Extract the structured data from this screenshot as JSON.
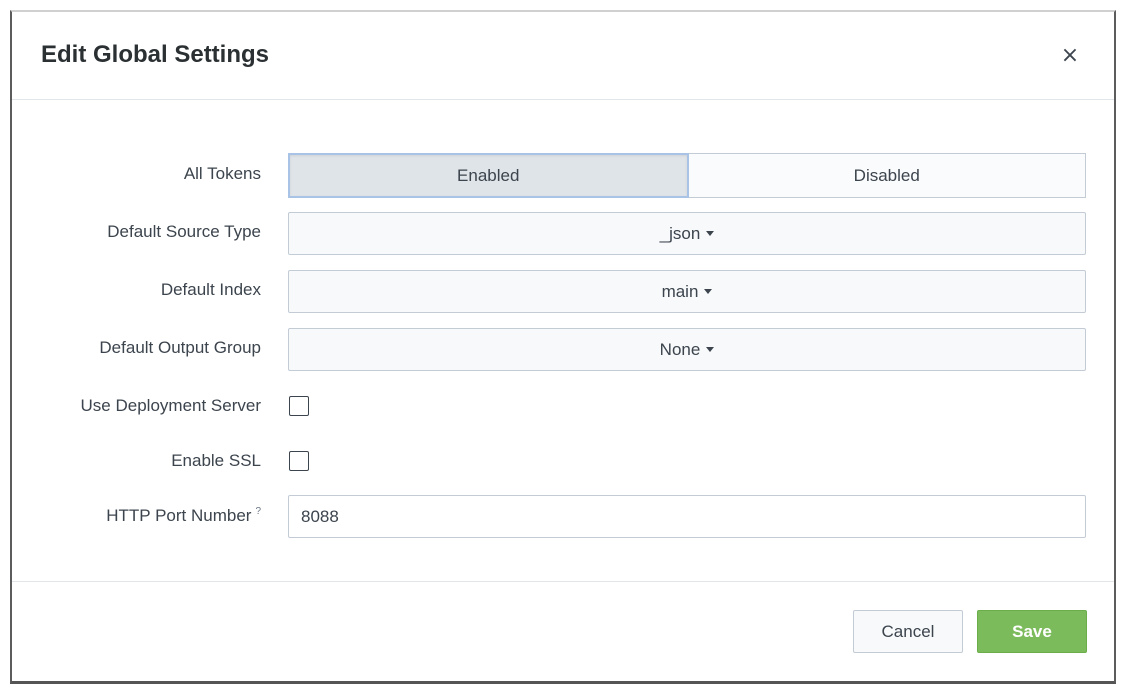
{
  "dialog": {
    "title": "Edit Global Settings",
    "close_glyph": "×"
  },
  "form": {
    "all_tokens": {
      "label": "All Tokens",
      "options": [
        "Enabled",
        "Disabled"
      ],
      "selected": "Enabled"
    },
    "default_source_type": {
      "label": "Default Source Type",
      "value": "_json"
    },
    "default_index": {
      "label": "Default Index",
      "value": "main"
    },
    "default_output_group": {
      "label": "Default Output Group",
      "value": "None"
    },
    "use_deployment_server": {
      "label": "Use Deployment Server",
      "checked": false
    },
    "enable_ssl": {
      "label": "Enable SSL",
      "checked": false
    },
    "http_port_number": {
      "label": "HTTP Port Number",
      "help_glyph": "?",
      "value": "8088"
    }
  },
  "footer": {
    "cancel_label": "Cancel",
    "save_label": "Save"
  },
  "colors": {
    "save_button": "#7cbb5c",
    "active_segment_border": "#a9c3e6",
    "text": "#3c444d"
  }
}
